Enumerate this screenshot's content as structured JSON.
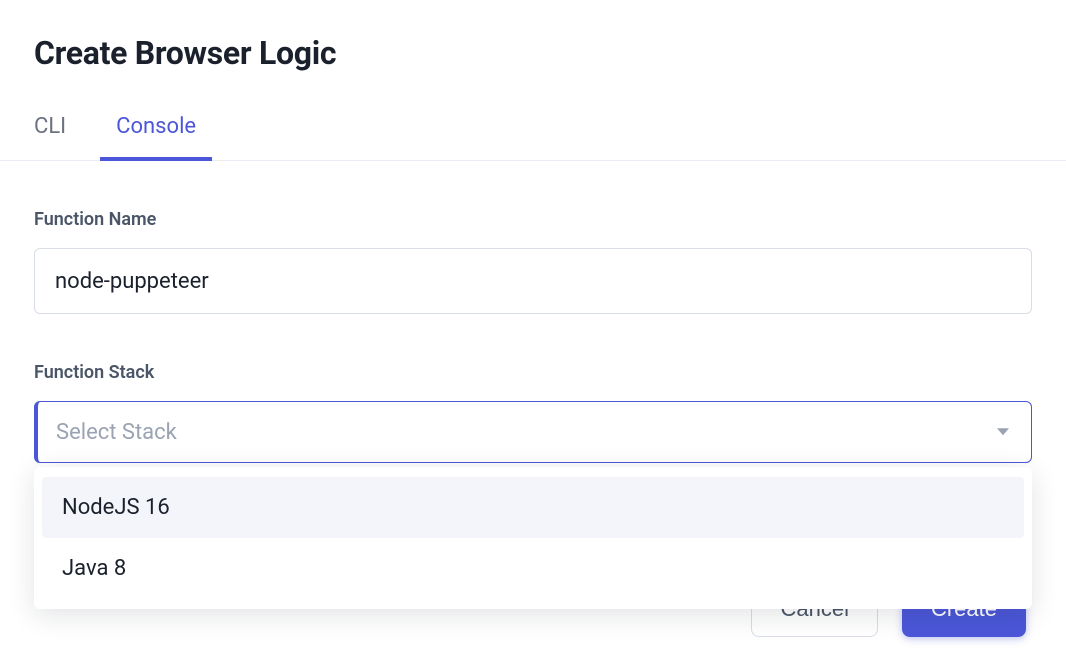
{
  "title": "Create Browser Logic",
  "tabs": {
    "cli": "CLI",
    "console": "Console",
    "active": "console"
  },
  "form": {
    "nameLabel": "Function Name",
    "nameValue": "node-puppeteer",
    "stackLabel": "Function Stack",
    "stackPlaceholder": "Select Stack",
    "stackOptions": [
      "NodeJS 16",
      "Java 8"
    ]
  },
  "actions": {
    "cancel": "Cancel",
    "create": "Create"
  }
}
